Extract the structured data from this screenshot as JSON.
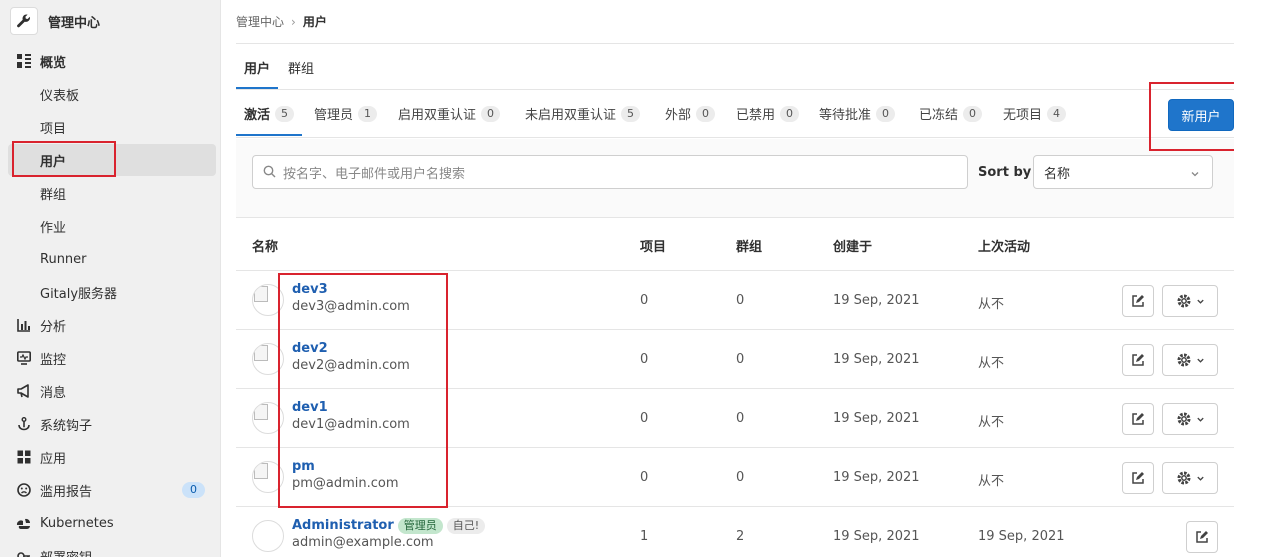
{
  "sidebar": {
    "title": "管理中心",
    "logo_icon": "wrench-icon",
    "items": [
      {
        "label": "概览",
        "icon": "overview-icon"
      },
      {
        "label": "仪表板"
      },
      {
        "label": "项目"
      },
      {
        "label": "用户"
      },
      {
        "label": "群组"
      },
      {
        "label": "作业"
      },
      {
        "label": "Runner"
      },
      {
        "label": "Gitaly服务器"
      },
      {
        "label": "分析",
        "icon": "chart-icon"
      },
      {
        "label": "监控",
        "icon": "monitor-icon"
      },
      {
        "label": "消息",
        "icon": "bullhorn-icon"
      },
      {
        "label": "系统钩子",
        "icon": "hook-icon"
      },
      {
        "label": "应用",
        "icon": "applications-icon"
      },
      {
        "label": "滥用报告",
        "icon": "abuse-icon",
        "badge": "0"
      },
      {
        "label": "Kubernetes",
        "icon": "kubernetes-icon"
      },
      {
        "label": "部署密钥",
        "icon": "key-icon"
      }
    ]
  },
  "breadcrumb": {
    "parent": "管理中心",
    "current": "用户"
  },
  "top_tabs": [
    {
      "label": "用户"
    },
    {
      "label": "群组"
    }
  ],
  "filter_tabs": [
    {
      "label": "激活",
      "count": "5"
    },
    {
      "label": "管理员",
      "count": "1"
    },
    {
      "label": "启用双重认证",
      "count": "0"
    },
    {
      "label": "未启用双重认证",
      "count": "5"
    },
    {
      "label": "外部",
      "count": "0"
    },
    {
      "label": "已禁用",
      "count": "0"
    },
    {
      "label": "等待批准",
      "count": "0"
    },
    {
      "label": "已冻结",
      "count": "0"
    },
    {
      "label": "无项目",
      "count": "4"
    }
  ],
  "new_user_label": "新用户",
  "search": {
    "placeholder": "按名字、电子邮件或用户名搜索"
  },
  "sort": {
    "label": "Sort by",
    "value": "名称"
  },
  "table": {
    "headers": [
      "名称",
      "项目",
      "群组",
      "创建于",
      "上次活动"
    ],
    "rows": [
      {
        "name": "dev3",
        "email": "dev3@admin.com",
        "projects": "0",
        "groups": "0",
        "created": "19 Sep, 2021",
        "last": "从不"
      },
      {
        "name": "dev2",
        "email": "dev2@admin.com",
        "projects": "0",
        "groups": "0",
        "created": "19 Sep, 2021",
        "last": "从不"
      },
      {
        "name": "dev1",
        "email": "dev1@admin.com",
        "projects": "0",
        "groups": "0",
        "created": "19 Sep, 2021",
        "last": "从不"
      },
      {
        "name": "pm",
        "email": "pm@admin.com",
        "projects": "0",
        "groups": "0",
        "created": "19 Sep, 2021",
        "last": "从不"
      },
      {
        "name": "Administrator",
        "badge_admin": "管理员",
        "badge_self": "自己!",
        "email": "admin@example.com",
        "projects": "1",
        "groups": "2",
        "created": "19 Sep, 2021",
        "last": "19 Sep, 2021"
      }
    ]
  },
  "colors": {
    "accent": "#1f75cb",
    "highlight": "#d9232e"
  }
}
